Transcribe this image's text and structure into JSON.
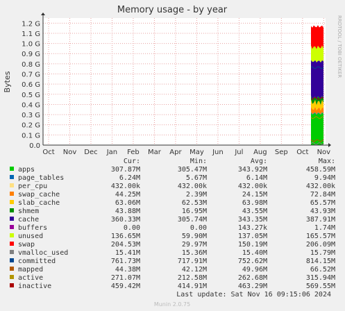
{
  "chart_data": {
    "type": "area",
    "title": "Memory usage - by year",
    "ylabel": "Bytes",
    "side_label": "RRDTOOL / TOBI OETIKER",
    "footer": "Munin 2.0.75",
    "last_update": "Last update: Sat Nov 16 09:15:06 2024",
    "x_ticks": [
      "Oct",
      "Nov",
      "Dec",
      "Jan",
      "Feb",
      "Mar",
      "Apr",
      "May",
      "Jun",
      "Jul",
      "Aug",
      "Sep",
      "Oct",
      "Nov"
    ],
    "y_ticks": [
      "0.0",
      "0.1 G",
      "0.2 G",
      "0.3 G",
      "0.4 G",
      "0.5 G",
      "0.6 G",
      "0.7 G",
      "0.8 G",
      "0.9 G",
      "1.0 G",
      "1.1 G",
      "1.2 G"
    ],
    "ylim": [
      0,
      1.25
    ],
    "grid": true,
    "legend_headers": [
      "Cur:",
      "Min:",
      "Avg:",
      "Max:"
    ],
    "series": [
      {
        "name": "apps",
        "color": "#00cc00",
        "cur": "307.87M",
        "min": "305.47M",
        "avg": "343.92M",
        "max": "458.59M"
      },
      {
        "name": "page_tables",
        "color": "#0066b3",
        "cur": "6.24M",
        "min": "5.67M",
        "avg": "6.14M",
        "max": "9.94M"
      },
      {
        "name": "per_cpu",
        "color": "#ffe082",
        "cur": "432.00k",
        "min": "432.00k",
        "avg": "432.00k",
        "max": "432.00k"
      },
      {
        "name": "swap_cache",
        "color": "#ff8000",
        "cur": "44.25M",
        "min": "2.39M",
        "avg": "24.15M",
        "max": "72.84M"
      },
      {
        "name": "slab_cache",
        "color": "#ffcc00",
        "cur": "63.06M",
        "min": "62.53M",
        "avg": "63.98M",
        "max": "65.57M"
      },
      {
        "name": "shmem",
        "color": "#008f00",
        "cur": "43.88M",
        "min": "16.95M",
        "avg": "43.55M",
        "max": "43.93M"
      },
      {
        "name": "cache",
        "color": "#330099",
        "cur": "360.33M",
        "min": "305.74M",
        "avg": "343.35M",
        "max": "387.91M"
      },
      {
        "name": "buffers",
        "color": "#990099",
        "cur": "0.00",
        "min": "0.00",
        "avg": "143.27k",
        "max": "1.74M"
      },
      {
        "name": "unused",
        "color": "#ccff00",
        "cur": "136.65M",
        "min": "59.90M",
        "avg": "137.05M",
        "max": "165.57M"
      },
      {
        "name": "swap",
        "color": "#ff0000",
        "cur": "204.53M",
        "min": "29.97M",
        "avg": "150.19M",
        "max": "206.09M"
      },
      {
        "name": "vmalloc_used",
        "color": "#808080",
        "cur": "15.41M",
        "min": "15.36M",
        "avg": "15.40M",
        "max": "15.79M"
      },
      {
        "name": "committed",
        "color": "#00478f",
        "cur": "761.73M",
        "min": "717.91M",
        "avg": "752.62M",
        "max": "814.15M"
      },
      {
        "name": "mapped",
        "color": "#b25900",
        "cur": "44.38M",
        "min": "42.12M",
        "avg": "49.96M",
        "max": "66.52M"
      },
      {
        "name": "active",
        "color": "#b29600",
        "cur": "271.07M",
        "min": "212.58M",
        "avg": "262.68M",
        "max": "315.94M"
      },
      {
        "name": "inactive",
        "color": "#aa0000",
        "cur": "459.42M",
        "min": "414.91M",
        "avg": "463.29M",
        "max": "569.55M"
      }
    ],
    "stack_values_gb": {
      "apps": 0.308,
      "page_tables": 0.006,
      "per_cpu": 0.0004,
      "swap_cache": 0.044,
      "slab_cache": 0.063,
      "shmem": 0.044,
      "cache": 0.36,
      "buffers": 0.0,
      "unused": 0.137,
      "swap": 0.205
    },
    "line_values_gb": {
      "vmalloc_used": 0.015,
      "committed": 0.762,
      "mapped": 0.044,
      "active": 0.271,
      "inactive": 0.459
    }
  }
}
